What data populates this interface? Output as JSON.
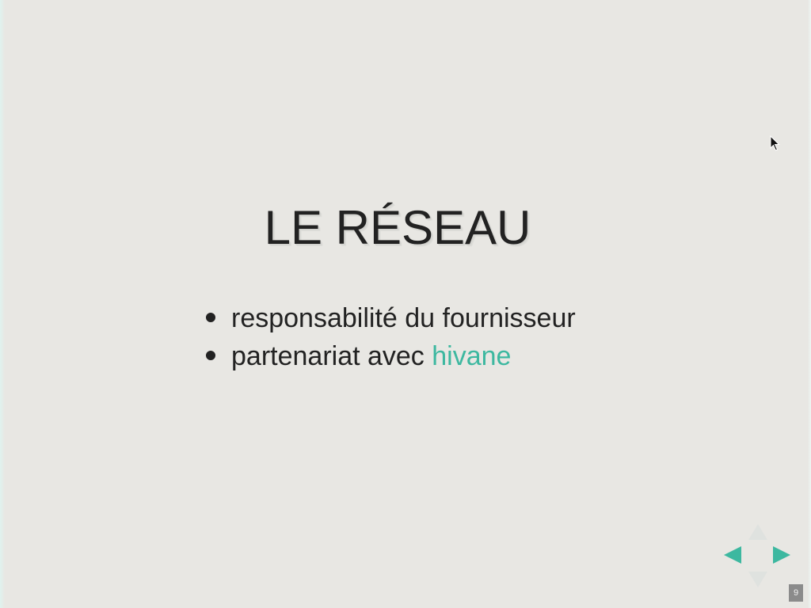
{
  "slide": {
    "title": "LE RÉSEAU",
    "bullets": [
      {
        "text": "responsabilité du fournisseur"
      },
      {
        "text": "partenariat avec ",
        "highlight": "hivane"
      }
    ],
    "number": "9"
  },
  "controls": {
    "up_icon": "arrow-up-icon",
    "down_icon": "arrow-down-icon",
    "left_icon": "arrow-left-icon",
    "right_icon": "arrow-right-icon"
  },
  "colors": {
    "background": "#e8e7e3",
    "text": "#222222",
    "accent": "#3db8a0"
  }
}
